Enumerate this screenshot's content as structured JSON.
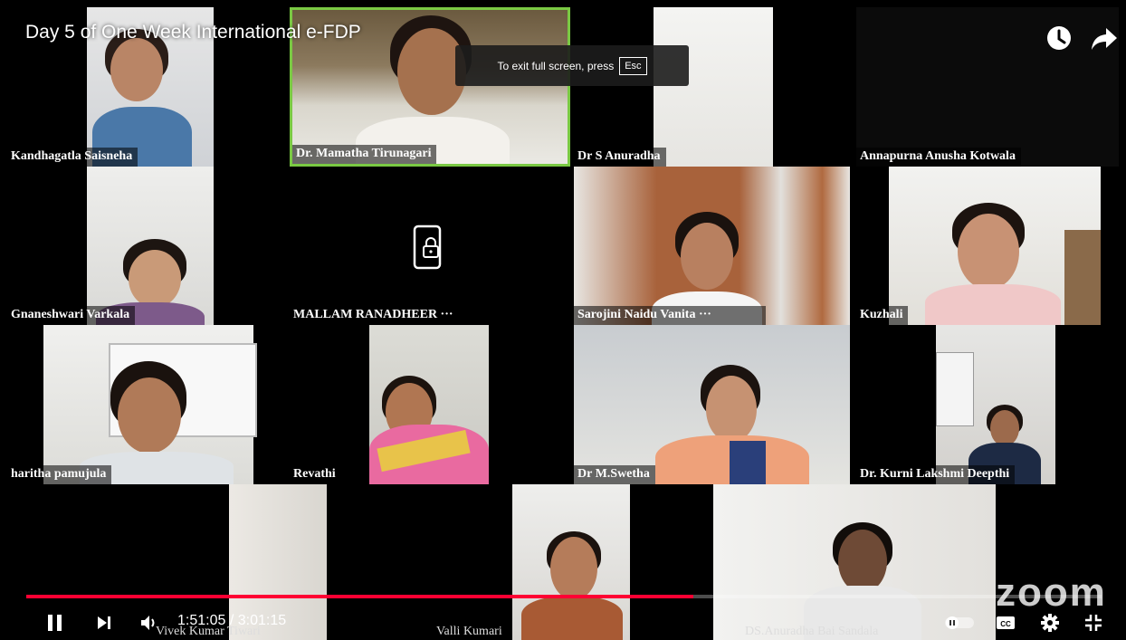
{
  "player": {
    "video_title": "Day 5 of One Week International e-FDP",
    "fullscreen_toast_text": "To exit full screen, press",
    "fullscreen_toast_key": "Esc",
    "time_current": "1:51:05",
    "time_separator": " / ",
    "time_total": "3:01:15",
    "progress_fraction": 0.62,
    "accent_color": "#ff0033",
    "icons": {
      "watch_later": "clock-icon",
      "share": "share-arrow-icon",
      "play_pause": "pause-icon",
      "next": "next-icon",
      "volume": "volume-icon",
      "autoplay": "autoplay-toggle-icon",
      "captions": "captions-icon",
      "settings": "gear-icon",
      "fullscreen": "exit-fullscreen-icon"
    }
  },
  "meeting": {
    "watermark": "zoom",
    "active_speaker_color": "#7ac943",
    "participants": [
      {
        "name": "Kandhagatla Saisneha"
      },
      {
        "name": "Dr. Mamatha Tirunagari"
      },
      {
        "name": "Dr S Anuradha"
      },
      {
        "name": "Annapurna Anusha Kotwala"
      },
      {
        "name": "Gnaneshwari Varkala"
      },
      {
        "name": "MALLAM RANADHEER ···"
      },
      {
        "name": "Sarojini Naidu Vanita ···"
      },
      {
        "name": "Kuzhali"
      },
      {
        "name": "haritha pamujula"
      },
      {
        "name": "Revathi"
      },
      {
        "name": "Dr M.Swetha"
      },
      {
        "name": "Dr. Kurni Lakshmi Deepthi"
      },
      {
        "name": "Vivek Kumar Tiwari"
      },
      {
        "name": "Valli Kumari"
      },
      {
        "name": "DS.Anuradha Bai Sandala"
      }
    ]
  }
}
